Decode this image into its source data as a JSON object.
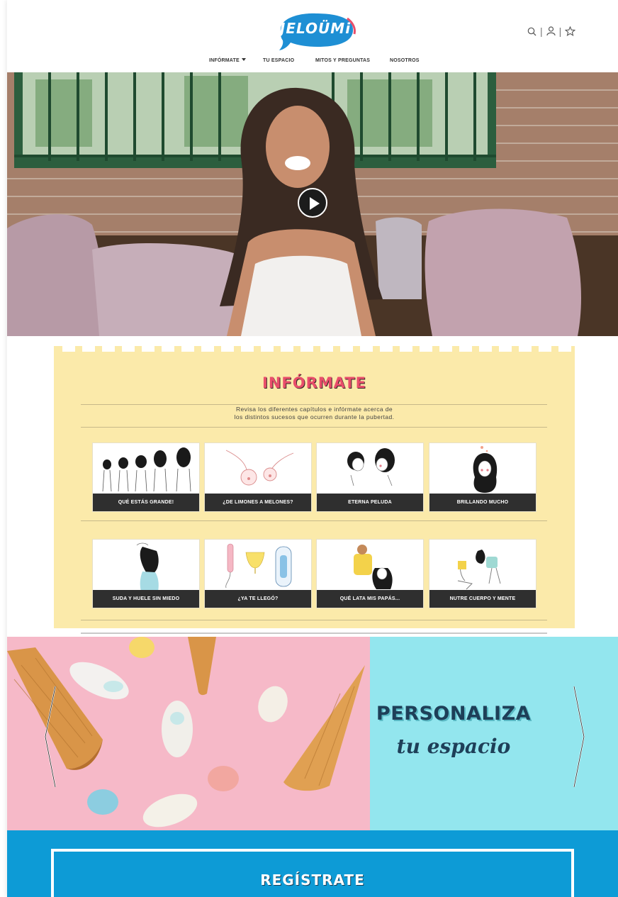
{
  "header": {
    "logo_text": "JELOÜMi",
    "icons": [
      "search-icon",
      "user-icon",
      "star-icon"
    ],
    "separator": "|"
  },
  "nav": {
    "items": [
      {
        "label": "INFÓRMATE",
        "has_dropdown": true
      },
      {
        "label": "TU ESPACIO"
      },
      {
        "label": "MITOS Y PREGUNTAS"
      },
      {
        "label": "NOSOTROS"
      }
    ]
  },
  "hero": {
    "icon": "play-icon"
  },
  "informate": {
    "title": "INFÓRMATE",
    "description_line1": "Revisa los diferentes capítulos e infórmate acerca de",
    "description_line2": "los distintos sucesos que ocurren durante la pubertad.",
    "cards": [
      {
        "label": "QUÉ ESTÁS GRANDE!"
      },
      {
        "label": "¿DE LIMONES A MELONES?"
      },
      {
        "label": "ETERNA PELUDA"
      },
      {
        "label": "BRILLANDO MUCHO"
      },
      {
        "label": "SUDA Y HUELE SIN MIEDO"
      },
      {
        "label": "¿YA TE LLEGÓ?"
      },
      {
        "label": "QUÉ LATA MIS PAPÁS..."
      },
      {
        "label": "NUTRE CUERPO Y MENTE"
      }
    ]
  },
  "banner": {
    "title": "PERSONALIZA",
    "subtitle": "tu espacio",
    "colors": {
      "pink": "#f7b7c6",
      "teal": "#93e6ee",
      "text": "#1e3f58"
    }
  },
  "register": {
    "label": "REGÍSTRATE",
    "color": "#0d9bd6"
  }
}
